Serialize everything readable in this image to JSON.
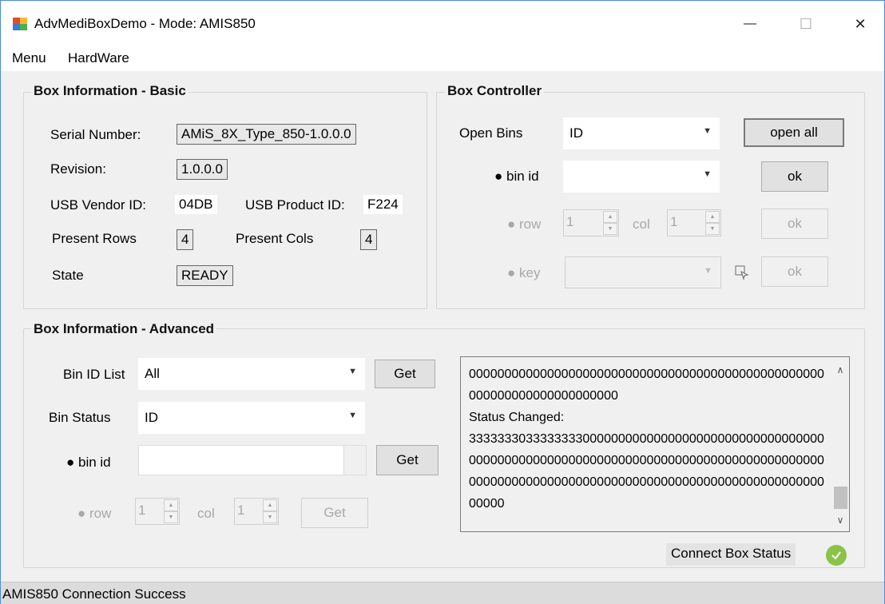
{
  "window": {
    "title": "AdvMediBoxDemo - Mode: AMIS850",
    "minimize_glyph": "—",
    "maximize_glyph": "☐",
    "close_glyph": "✕"
  },
  "menu": {
    "items": [
      "Menu",
      "HardWare"
    ]
  },
  "basic": {
    "title": "Box Information - Basic",
    "serial_label": "Serial Number:",
    "serial_value": "AMiS_8X_Type_850-1.0.0.0",
    "revision_label": "Revision:",
    "revision_value": "1.0.0.0",
    "vendor_label": "USB Vendor ID:",
    "vendor_value": "04DB",
    "product_label": "USB Product ID:",
    "product_value": "F224",
    "rows_label": "Present Rows",
    "rows_value": "4",
    "cols_label": "Present Cols",
    "cols_value": "4",
    "state_label": "State",
    "state_value": "READY"
  },
  "controller": {
    "title": "Box Controller",
    "open_bins_label": "Open Bins",
    "open_bins_value": "ID",
    "open_all_label": "open all",
    "bin_id_label": "● bin id",
    "bin_id_value": "",
    "ok_label": "ok",
    "row_label": "● row",
    "row_value": "1",
    "col_label": "col",
    "col_value": "1",
    "key_label": "● key",
    "key_value": ""
  },
  "advanced": {
    "title": "Box Information - Advanced",
    "bin_id_list_label": "Bin ID List",
    "bin_id_list_value": "All",
    "get_label": "Get",
    "bin_status_label": "Bin Status",
    "bin_status_value": "ID",
    "bin_id_label": "● bin id",
    "bin_id_value": "",
    "row_label": "● row",
    "row_value": "1",
    "col_label": "col",
    "col_value": "1"
  },
  "log": {
    "text": "00000000000000000000000000000000000000000000000000000000000000000000000\nStatus Changed:\n33333330333333330000000000000000000000000000000000000000000000000000000000000000000000000000000000000000000000000000000000000000000000000000000000000000000"
  },
  "connect_status_label": "Connect Box Status",
  "status_bar_text": "AMIS850 Connection Success",
  "colors": {
    "ok": "#8bc34a",
    "accent_border": "#4a8ad9"
  }
}
